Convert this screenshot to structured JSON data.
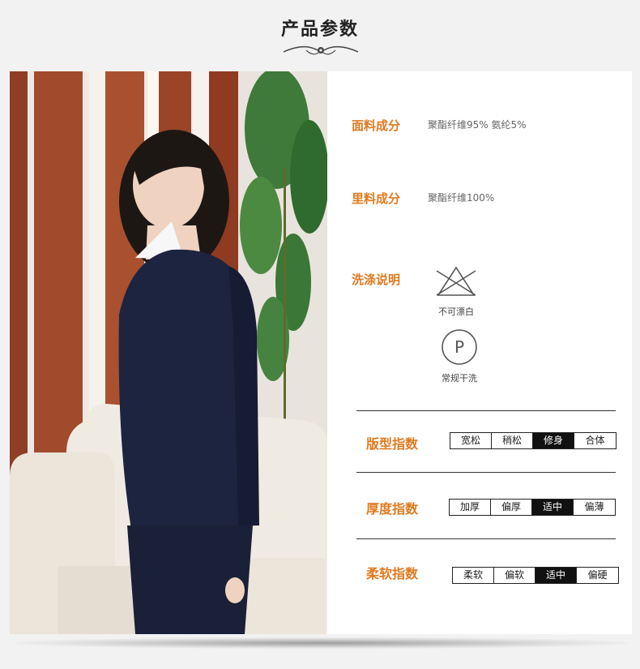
{
  "title": "产品参数",
  "params": [
    {
      "label": "面料成分",
      "value": "聚酯纤维95%  氨纶5%"
    },
    {
      "label": "里料成分",
      "value": "聚酯纤维100%"
    }
  ],
  "wash": {
    "label": "洗涤说明",
    "items": [
      {
        "icon": "no-bleach-icon",
        "caption": "不可漂白"
      },
      {
        "icon": "dry-clean-p-icon",
        "caption": "常规干洗",
        "symbol": "P"
      }
    ]
  },
  "indices": [
    {
      "label": "版型指数",
      "options": [
        "宽松",
        "稍松",
        "修身",
        "合体"
      ],
      "selected": 2
    },
    {
      "label": "厚度指数",
      "options": [
        "加厚",
        "偏厚",
        "适中",
        "偏薄"
      ],
      "selected": 2
    },
    {
      "label": "柔软指数",
      "options": [
        "柔软",
        "偏软",
        "适中",
        "偏硬"
      ],
      "selected": 2
    }
  ],
  "colors": {
    "accent": "#e07a1f",
    "selected": "#111111"
  }
}
